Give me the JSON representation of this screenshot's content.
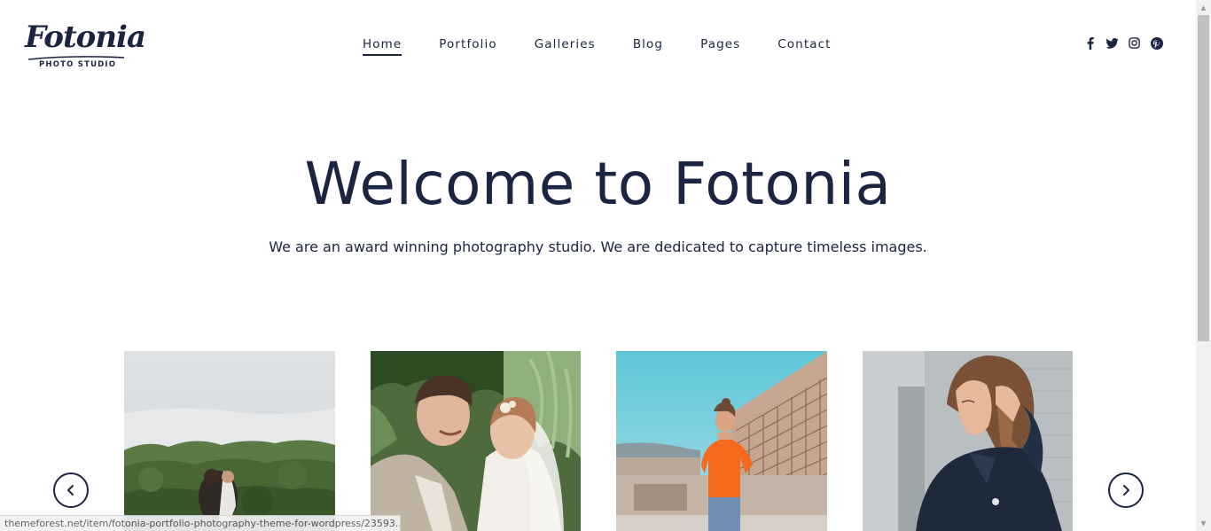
{
  "brand": {
    "name": "Fotonia",
    "tagline": "PHOTO STUDIO"
  },
  "nav": {
    "items": [
      {
        "label": "Home",
        "active": true
      },
      {
        "label": "Portfolio",
        "active": false
      },
      {
        "label": "Galleries",
        "active": false
      },
      {
        "label": "Blog",
        "active": false
      },
      {
        "label": "Pages",
        "active": false
      },
      {
        "label": "Contact",
        "active": false
      }
    ]
  },
  "social": [
    "facebook-icon",
    "twitter-icon",
    "instagram-icon",
    "pinterest-icon"
  ],
  "hero": {
    "title": "Welcome to Fotonia",
    "subtitle": "We are an award winning photography studio. We are dedicated to capture timeless images."
  },
  "gallery": {
    "photos": [
      "couple-embrace-photo",
      "wedding-couple-photo",
      "woman-orange-shirt-photo",
      "woman-denim-jacket-photo"
    ]
  },
  "slider": {
    "prev_icon": "chevron-left-icon",
    "next_icon": "chevron-right-icon"
  },
  "status_bar": {
    "url": "themeforest.net/item/fotonia-portfolio-photography-theme-for-wordpress/23593..."
  },
  "colors": {
    "text": "#1b2440",
    "background": "#ffffff"
  }
}
